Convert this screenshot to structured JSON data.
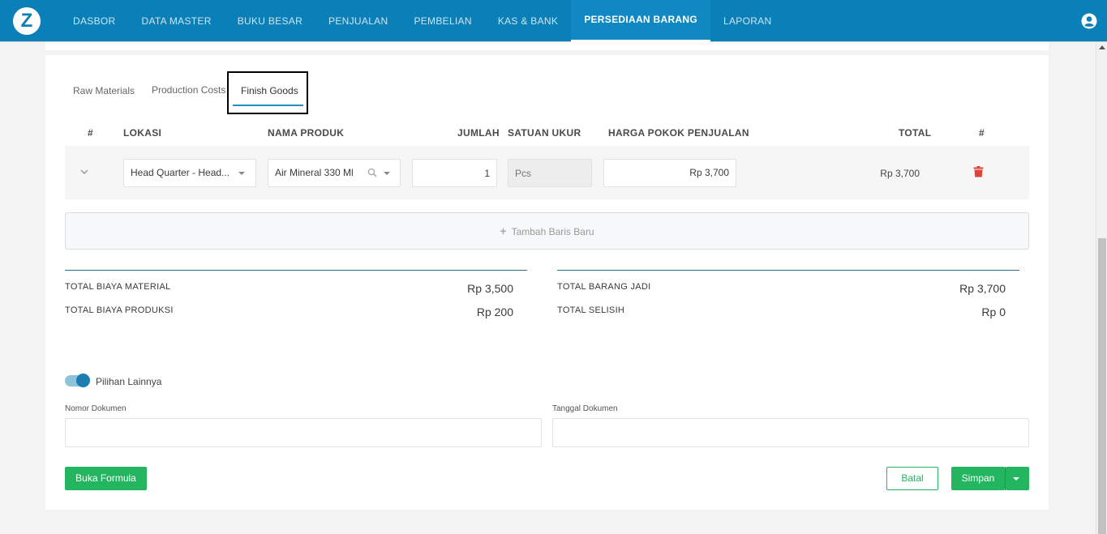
{
  "header": {
    "logo_letter": "Z",
    "nav": [
      "DASBOR",
      "DATA MASTER",
      "BUKU BESAR",
      "PENJUALAN",
      "PEMBELIAN",
      "KAS & BANK",
      "PERSEDIAAN BARANG",
      "LAPORAN"
    ],
    "active_nav": "PERSEDIAAN BARANG",
    "brand_color": "#0b7fb8"
  },
  "tabs": [
    "Raw Materials",
    "Production Costs",
    "Finish Goods"
  ],
  "active_tab": "Finish Goods",
  "table": {
    "headers": [
      "#",
      "LOKASI",
      "NAMA PRODUK",
      "JUMLAH",
      "SATUAN UKUR",
      "HARGA POKOK PENJUALAN",
      "TOTAL",
      "#"
    ],
    "row": {
      "lokasi": "Head Quarter - Head...",
      "nama_produk": "Air Mineral 330 Ml",
      "jumlah": "1",
      "satuan_placeholder": "Pcs",
      "harga": "Rp 3,700",
      "total": "Rp 3,700"
    }
  },
  "add_row_label": "Tambah Baris Baru",
  "summary": {
    "left": [
      {
        "label": "TOTAL BIAYA MATERIAL",
        "value": "Rp 3,500"
      },
      {
        "label": "TOTAL BIAYA PRODUKSI",
        "value": "Rp 200"
      }
    ],
    "right": [
      {
        "label": "TOTAL BARANG JADI",
        "value": "Rp 3,700"
      },
      {
        "label": "TOTAL SELISIH",
        "value": "Rp 0"
      }
    ]
  },
  "options": {
    "toggle_label": "Pilihan Lainnya",
    "nomor_label": "Nomor Dokumen",
    "tanggal_label": "Tanggal Dokumen"
  },
  "buttons": {
    "buka_formula": "Buka Formula",
    "batal": "Batal",
    "simpan": "Simpan"
  },
  "colors": {
    "accent_green": "#23b55f",
    "delete_red": "#d9453b"
  }
}
